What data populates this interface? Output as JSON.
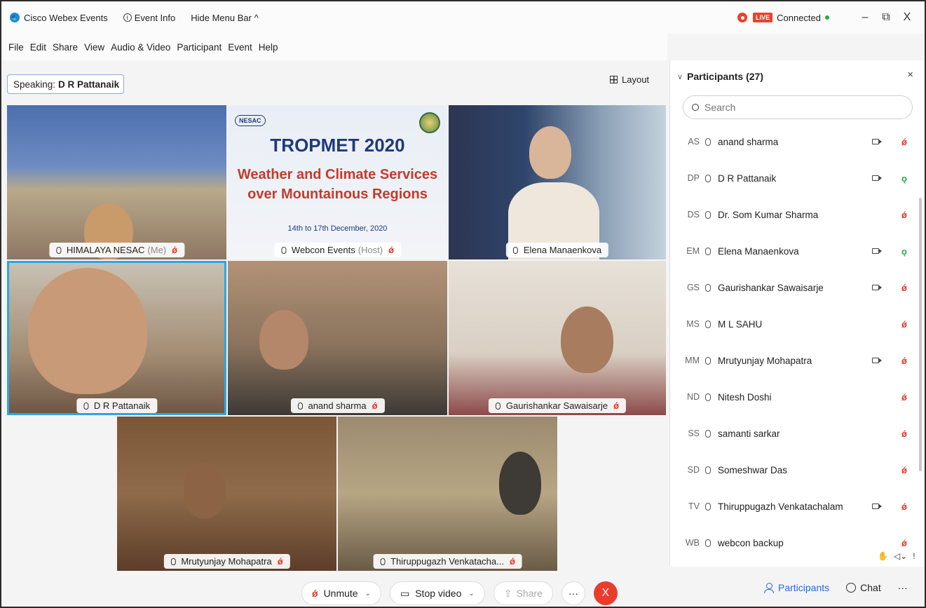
{
  "titlebar": {
    "app_name": "Cisco Webex Events",
    "event_info": "Event Info",
    "hide_menu": "Hide Menu Bar ^",
    "live": "LIVE",
    "connected": "Connected",
    "minimize": "–",
    "restore": "⧉",
    "close": "X"
  },
  "menu": [
    "File",
    "Edit",
    "Share",
    "View",
    "Audio & Video",
    "Participant",
    "Event",
    "Help"
  ],
  "stage": {
    "speaking_label": "Speaking:",
    "speaking_name": "D R Pattanaik",
    "layout_label": "Layout"
  },
  "banner": {
    "title": "TROPMET 2020",
    "line1": "Weather and Climate Services",
    "line2": "over Mountainous Regions",
    "date": "14th to 17th December, 2020",
    "logo": "NESAC"
  },
  "tiles": [
    {
      "name": "HIMALAYA NESAC",
      "sub": "(Me)",
      "muted": true
    },
    {
      "name": "Webcon Events",
      "sub": "(Host)",
      "muted": true
    },
    {
      "name": "Elena Manaenkova",
      "sub": "",
      "muted": false
    },
    {
      "name": "D R Pattanaik",
      "sub": "",
      "muted": false
    },
    {
      "name": "anand sharma",
      "sub": "",
      "muted": true
    },
    {
      "name": "Gaurishankar Sawaisarje",
      "sub": "",
      "muted": true
    },
    {
      "name": "Mrutyunjay Mohapatra",
      "sub": "",
      "muted": true
    },
    {
      "name": "Thiruppugazh Venkatacha...",
      "sub": "",
      "muted": true
    }
  ],
  "controls": {
    "unmute": "Unmute",
    "stop_video": "Stop video",
    "share": "Share",
    "more": "···",
    "end": "X"
  },
  "panel": {
    "title": "Participants (27)",
    "search_placeholder": "Search",
    "participants": [
      {
        "initials": "AS",
        "name": "anand sharma",
        "video": true,
        "audio": "muted"
      },
      {
        "initials": "DP",
        "name": "D R Pattanaik",
        "video": true,
        "audio": "on"
      },
      {
        "initials": "DS",
        "name": "Dr. Som Kumar Sharma",
        "video": false,
        "audio": "muted"
      },
      {
        "initials": "EM",
        "name": "Elena Manaenkova",
        "video": true,
        "audio": "on"
      },
      {
        "initials": "GS",
        "name": "Gaurishankar Sawaisarje",
        "video": true,
        "audio": "muted"
      },
      {
        "initials": "MS",
        "name": "M L SAHU",
        "video": false,
        "audio": "muted"
      },
      {
        "initials": "MM",
        "name": "Mrutyunjay Mohapatra",
        "video": true,
        "audio": "muted"
      },
      {
        "initials": "ND",
        "name": "Nitesh Doshi",
        "video": false,
        "audio": "muted"
      },
      {
        "initials": "SS",
        "name": "samanti sarkar",
        "video": false,
        "audio": "muted"
      },
      {
        "initials": "SD",
        "name": "Someshwar Das",
        "video": false,
        "audio": "muted"
      },
      {
        "initials": "TV",
        "name": "Thiruppugazh Venkatachalam",
        "video": true,
        "audio": "muted"
      },
      {
        "initials": "WB",
        "name": "webcon backup",
        "video": false,
        "audio": "muted"
      }
    ]
  },
  "bottom": {
    "participants": "Participants",
    "chat": "Chat",
    "more": "···"
  }
}
